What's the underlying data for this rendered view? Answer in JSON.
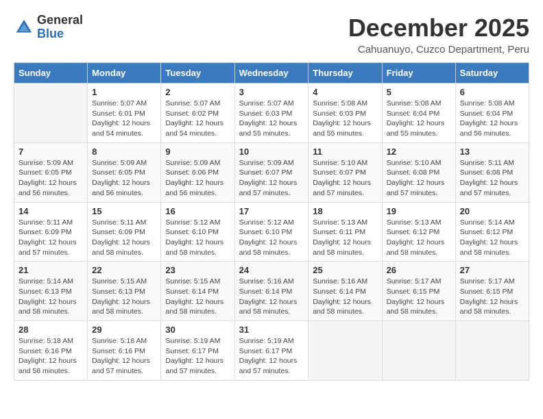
{
  "header": {
    "logo_general": "General",
    "logo_blue": "Blue",
    "month_year": "December 2025",
    "location": "Cahuanuyo, Cuzco Department, Peru"
  },
  "weekdays": [
    "Sunday",
    "Monday",
    "Tuesday",
    "Wednesday",
    "Thursday",
    "Friday",
    "Saturday"
  ],
  "weeks": [
    [
      {
        "day": "",
        "sunrise": "",
        "sunset": "",
        "daylight": ""
      },
      {
        "day": "1",
        "sunrise": "Sunrise: 5:07 AM",
        "sunset": "Sunset: 6:01 PM",
        "daylight": "Daylight: 12 hours and 54 minutes."
      },
      {
        "day": "2",
        "sunrise": "Sunrise: 5:07 AM",
        "sunset": "Sunset: 6:02 PM",
        "daylight": "Daylight: 12 hours and 54 minutes."
      },
      {
        "day": "3",
        "sunrise": "Sunrise: 5:07 AM",
        "sunset": "Sunset: 6:03 PM",
        "daylight": "Daylight: 12 hours and 55 minutes."
      },
      {
        "day": "4",
        "sunrise": "Sunrise: 5:08 AM",
        "sunset": "Sunset: 6:03 PM",
        "daylight": "Daylight: 12 hours and 55 minutes."
      },
      {
        "day": "5",
        "sunrise": "Sunrise: 5:08 AM",
        "sunset": "Sunset: 6:04 PM",
        "daylight": "Daylight: 12 hours and 55 minutes."
      },
      {
        "day": "6",
        "sunrise": "Sunrise: 5:08 AM",
        "sunset": "Sunset: 6:04 PM",
        "daylight": "Daylight: 12 hours and 56 minutes."
      }
    ],
    [
      {
        "day": "7",
        "sunrise": "Sunrise: 5:09 AM",
        "sunset": "Sunset: 6:05 PM",
        "daylight": "Daylight: 12 hours and 56 minutes."
      },
      {
        "day": "8",
        "sunrise": "Sunrise: 5:09 AM",
        "sunset": "Sunset: 6:05 PM",
        "daylight": "Daylight: 12 hours and 56 minutes."
      },
      {
        "day": "9",
        "sunrise": "Sunrise: 5:09 AM",
        "sunset": "Sunset: 6:06 PM",
        "daylight": "Daylight: 12 hours and 56 minutes."
      },
      {
        "day": "10",
        "sunrise": "Sunrise: 5:09 AM",
        "sunset": "Sunset: 6:07 PM",
        "daylight": "Daylight: 12 hours and 57 minutes."
      },
      {
        "day": "11",
        "sunrise": "Sunrise: 5:10 AM",
        "sunset": "Sunset: 6:07 PM",
        "daylight": "Daylight: 12 hours and 57 minutes."
      },
      {
        "day": "12",
        "sunrise": "Sunrise: 5:10 AM",
        "sunset": "Sunset: 6:08 PM",
        "daylight": "Daylight: 12 hours and 57 minutes."
      },
      {
        "day": "13",
        "sunrise": "Sunrise: 5:11 AM",
        "sunset": "Sunset: 6:08 PM",
        "daylight": "Daylight: 12 hours and 57 minutes."
      }
    ],
    [
      {
        "day": "14",
        "sunrise": "Sunrise: 5:11 AM",
        "sunset": "Sunset: 6:09 PM",
        "daylight": "Daylight: 12 hours and 57 minutes."
      },
      {
        "day": "15",
        "sunrise": "Sunrise: 5:11 AM",
        "sunset": "Sunset: 6:09 PM",
        "daylight": "Daylight: 12 hours and 58 minutes."
      },
      {
        "day": "16",
        "sunrise": "Sunrise: 5:12 AM",
        "sunset": "Sunset: 6:10 PM",
        "daylight": "Daylight: 12 hours and 58 minutes."
      },
      {
        "day": "17",
        "sunrise": "Sunrise: 5:12 AM",
        "sunset": "Sunset: 6:10 PM",
        "daylight": "Daylight: 12 hours and 58 minutes."
      },
      {
        "day": "18",
        "sunrise": "Sunrise: 5:13 AM",
        "sunset": "Sunset: 6:11 PM",
        "daylight": "Daylight: 12 hours and 58 minutes."
      },
      {
        "day": "19",
        "sunrise": "Sunrise: 5:13 AM",
        "sunset": "Sunset: 6:12 PM",
        "daylight": "Daylight: 12 hours and 58 minutes."
      },
      {
        "day": "20",
        "sunrise": "Sunrise: 5:14 AM",
        "sunset": "Sunset: 6:12 PM",
        "daylight": "Daylight: 12 hours and 58 minutes."
      }
    ],
    [
      {
        "day": "21",
        "sunrise": "Sunrise: 5:14 AM",
        "sunset": "Sunset: 6:13 PM",
        "daylight": "Daylight: 12 hours and 58 minutes."
      },
      {
        "day": "22",
        "sunrise": "Sunrise: 5:15 AM",
        "sunset": "Sunset: 6:13 PM",
        "daylight": "Daylight: 12 hours and 58 minutes."
      },
      {
        "day": "23",
        "sunrise": "Sunrise: 5:15 AM",
        "sunset": "Sunset: 6:14 PM",
        "daylight": "Daylight: 12 hours and 58 minutes."
      },
      {
        "day": "24",
        "sunrise": "Sunrise: 5:16 AM",
        "sunset": "Sunset: 6:14 PM",
        "daylight": "Daylight: 12 hours and 58 minutes."
      },
      {
        "day": "25",
        "sunrise": "Sunrise: 5:16 AM",
        "sunset": "Sunset: 6:14 PM",
        "daylight": "Daylight: 12 hours and 58 minutes."
      },
      {
        "day": "26",
        "sunrise": "Sunrise: 5:17 AM",
        "sunset": "Sunset: 6:15 PM",
        "daylight": "Daylight: 12 hours and 58 minutes."
      },
      {
        "day": "27",
        "sunrise": "Sunrise: 5:17 AM",
        "sunset": "Sunset: 6:15 PM",
        "daylight": "Daylight: 12 hours and 58 minutes."
      }
    ],
    [
      {
        "day": "28",
        "sunrise": "Sunrise: 5:18 AM",
        "sunset": "Sunset: 6:16 PM",
        "daylight": "Daylight: 12 hours and 58 minutes."
      },
      {
        "day": "29",
        "sunrise": "Sunrise: 5:18 AM",
        "sunset": "Sunset: 6:16 PM",
        "daylight": "Daylight: 12 hours and 57 minutes."
      },
      {
        "day": "30",
        "sunrise": "Sunrise: 5:19 AM",
        "sunset": "Sunset: 6:17 PM",
        "daylight": "Daylight: 12 hours and 57 minutes."
      },
      {
        "day": "31",
        "sunrise": "Sunrise: 5:19 AM",
        "sunset": "Sunset: 6:17 PM",
        "daylight": "Daylight: 12 hours and 57 minutes."
      },
      {
        "day": "",
        "sunrise": "",
        "sunset": "",
        "daylight": ""
      },
      {
        "day": "",
        "sunrise": "",
        "sunset": "",
        "daylight": ""
      },
      {
        "day": "",
        "sunrise": "",
        "sunset": "",
        "daylight": ""
      }
    ]
  ]
}
